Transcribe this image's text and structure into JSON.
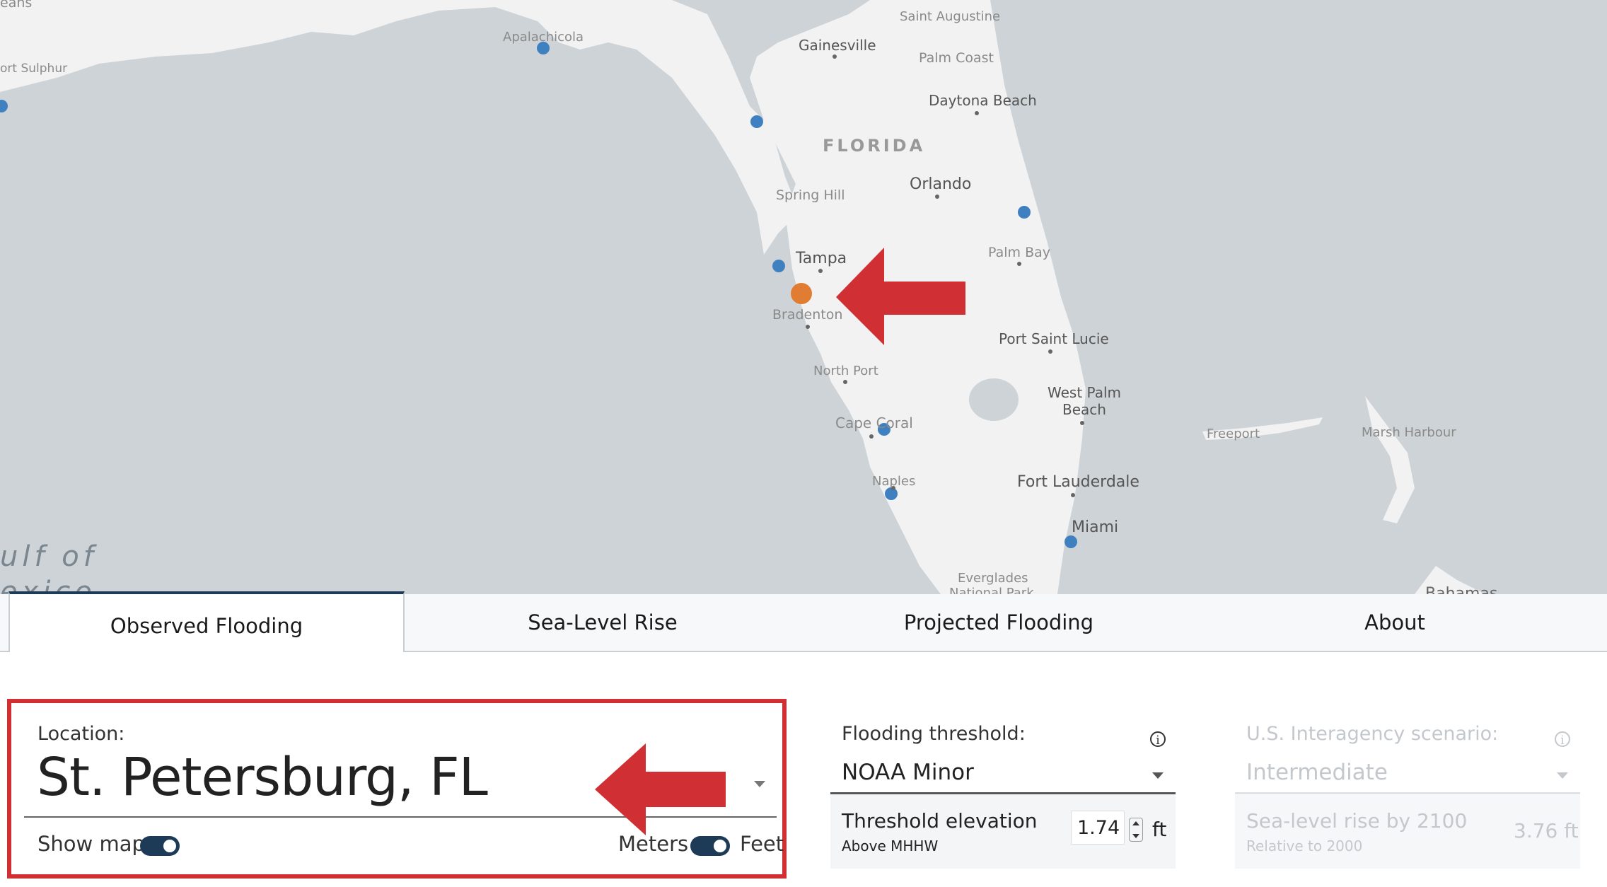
{
  "map": {
    "place_labels": {
      "saint_augustine": "Saint Augustine",
      "gainesville": "Gainesville",
      "palm_coast": "Palm Coast",
      "apalachicola": "Apalachicola",
      "port_sulphur": "ort Sulphur",
      "orleans": "eans",
      "daytona_beach": "Daytona Beach",
      "florida": "FLORIDA",
      "orlando": "Orlando",
      "spring_hill": "Spring Hill",
      "palm_bay": "Palm Bay",
      "tampa": "Tampa",
      "bradenton": "Bradenton",
      "port_saint_lucie": "Port Saint Lucie",
      "north_port": "North Port",
      "west_palm_beach_1": "West Palm",
      "west_palm_beach_2": "Beach",
      "cape_coral": "Cape Coral",
      "freeport": "Freeport",
      "marsh_harbour": "Marsh Harbour",
      "naples": "Naples",
      "fort_lauderdale": "Fort Lauderdale",
      "miami": "Miami",
      "gulf_1": "ulf of",
      "gulf_2": "exico",
      "everglades_1": "Everglades",
      "everglades_2": "National Park",
      "bahamas": "Bahamas"
    },
    "colors": {
      "water": "#cdd3d6",
      "land": "#f2f2f2",
      "station": "#3f80c0",
      "selected_station": "#e07d33",
      "arrow": "#d02f33"
    }
  },
  "tabs": [
    {
      "label": "Observed Flooding",
      "active": true
    },
    {
      "label": "Sea-Level Rise",
      "active": false
    },
    {
      "label": "Projected Flooding",
      "active": false
    },
    {
      "label": "About",
      "active": false
    }
  ],
  "location": {
    "label": "Location:",
    "value": "St. Petersburg, FL",
    "show_map_label": "Show map",
    "units_left": "Meters",
    "units_right": "Feet"
  },
  "threshold": {
    "label": "Flooding threshold:",
    "selected": "NOAA Minor",
    "elevation_title": "Threshold elevation",
    "elevation_note": "Above MHHW",
    "elevation_value": "1.74",
    "elevation_unit": "ft",
    "info_glyph": "i"
  },
  "scenario": {
    "label": "U.S. Interagency scenario:",
    "selected": "Intermediate",
    "rise_title": "Sea-level rise by 2100",
    "rise_note": "Relative to 2000",
    "rise_value": "3.76 ft",
    "info_glyph": "i"
  }
}
